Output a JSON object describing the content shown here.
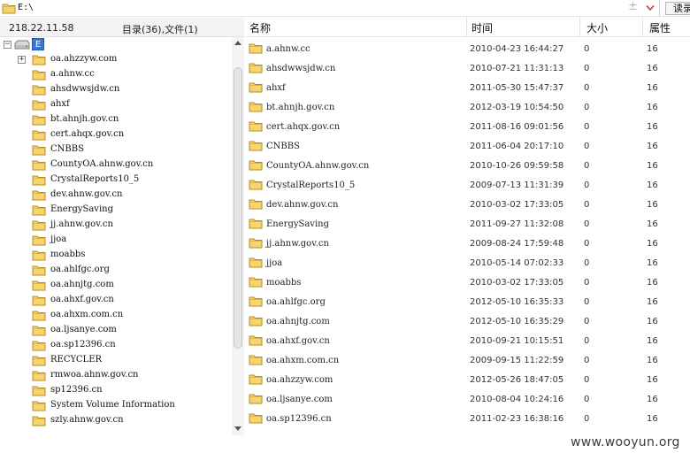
{
  "address": {
    "path": "E:\\",
    "read_label": "读录"
  },
  "left_header": {
    "ip": "218.22.11.58",
    "counts": "目录(36),文件(1)"
  },
  "tree": {
    "drive_label": "E",
    "items": [
      {
        "label": "oa.ahzzyw.com",
        "expandable": true
      },
      {
        "label": "a.ahnw.cc"
      },
      {
        "label": "ahsdwwsjdw.cn"
      },
      {
        "label": "ahxf"
      },
      {
        "label": "bt.ahnjh.gov.cn"
      },
      {
        "label": "cert.ahqx.gov.cn"
      },
      {
        "label": "CNBBS"
      },
      {
        "label": "CountyOA.ahnw.gov.cn"
      },
      {
        "label": "CrystalReports10_5"
      },
      {
        "label": "dev.ahnw.gov.cn"
      },
      {
        "label": "EnergySaving"
      },
      {
        "label": "jj.ahnw.gov.cn"
      },
      {
        "label": "jjoa"
      },
      {
        "label": "moabbs"
      },
      {
        "label": "oa.ahlfgc.org"
      },
      {
        "label": "oa.ahnjtg.com"
      },
      {
        "label": "oa.ahxf.gov.cn"
      },
      {
        "label": "oa.ahxm.com.cn"
      },
      {
        "label": "oa.ljsanye.com"
      },
      {
        "label": "oa.sp12396.cn"
      },
      {
        "label": "RECYCLER"
      },
      {
        "label": "rmwoa.ahnw.gov.cn"
      },
      {
        "label": "sp12396.cn"
      },
      {
        "label": "System Volume Information"
      },
      {
        "label": "szly.ahnw.gov.cn"
      }
    ]
  },
  "columns": {
    "name": "名称",
    "time": "时间",
    "size": "大小",
    "attr": "属性"
  },
  "files": [
    {
      "name": "a.ahnw.cc",
      "time": "2010-04-23 16:44:27",
      "size": "0",
      "attr": "16"
    },
    {
      "name": "ahsdwwsjdw.cn",
      "time": "2010-07-21 11:31:13",
      "size": "0",
      "attr": "16"
    },
    {
      "name": "ahxf",
      "time": "2011-05-30 15:47:37",
      "size": "0",
      "attr": "16"
    },
    {
      "name": "bt.ahnjh.gov.cn",
      "time": "2012-03-19 10:54:50",
      "size": "0",
      "attr": "16"
    },
    {
      "name": "cert.ahqx.gov.cn",
      "time": "2011-08-16 09:01:56",
      "size": "0",
      "attr": "16"
    },
    {
      "name": "CNBBS",
      "time": "2011-06-04 20:17:10",
      "size": "0",
      "attr": "16"
    },
    {
      "name": "CountyOA.ahnw.gov.cn",
      "time": "2010-10-26 09:59:58",
      "size": "0",
      "attr": "16"
    },
    {
      "name": "CrystalReports10_5",
      "time": "2009-07-13 11:31:39",
      "size": "0",
      "attr": "16"
    },
    {
      "name": "dev.ahnw.gov.cn",
      "time": "2010-03-02 17:33:05",
      "size": "0",
      "attr": "16"
    },
    {
      "name": "EnergySaving",
      "time": "2011-09-27 11:32:08",
      "size": "0",
      "attr": "16"
    },
    {
      "name": "jj.ahnw.gov.cn",
      "time": "2009-08-24 17:59:48",
      "size": "0",
      "attr": "16"
    },
    {
      "name": "jjoa",
      "time": "2010-05-14 07:02:33",
      "size": "0",
      "attr": "16"
    },
    {
      "name": "moabbs",
      "time": "2010-03-02 17:33:05",
      "size": "0",
      "attr": "16"
    },
    {
      "name": "oa.ahlfgc.org",
      "time": "2012-05-10 16:35:33",
      "size": "0",
      "attr": "16"
    },
    {
      "name": "oa.ahnjtg.com",
      "time": "2012-05-10 16:35:29",
      "size": "0",
      "attr": "16"
    },
    {
      "name": "oa.ahxf.gov.cn",
      "time": "2010-09-21 10:15:51",
      "size": "0",
      "attr": "16"
    },
    {
      "name": "oa.ahxm.com.cn",
      "time": "2009-09-15 11:22:59",
      "size": "0",
      "attr": "16"
    },
    {
      "name": "oa.ahzzyw.com",
      "time": "2012-05-26 18:47:05",
      "size": "0",
      "attr": "16"
    },
    {
      "name": "oa.ljsanye.com",
      "time": "2010-08-04 10:24:16",
      "size": "0",
      "attr": "16"
    },
    {
      "name": "oa.sp12396.cn",
      "time": "2011-02-23 16:38:16",
      "size": "0",
      "attr": "16"
    }
  ],
  "watermark": "www.wooyun.org"
}
